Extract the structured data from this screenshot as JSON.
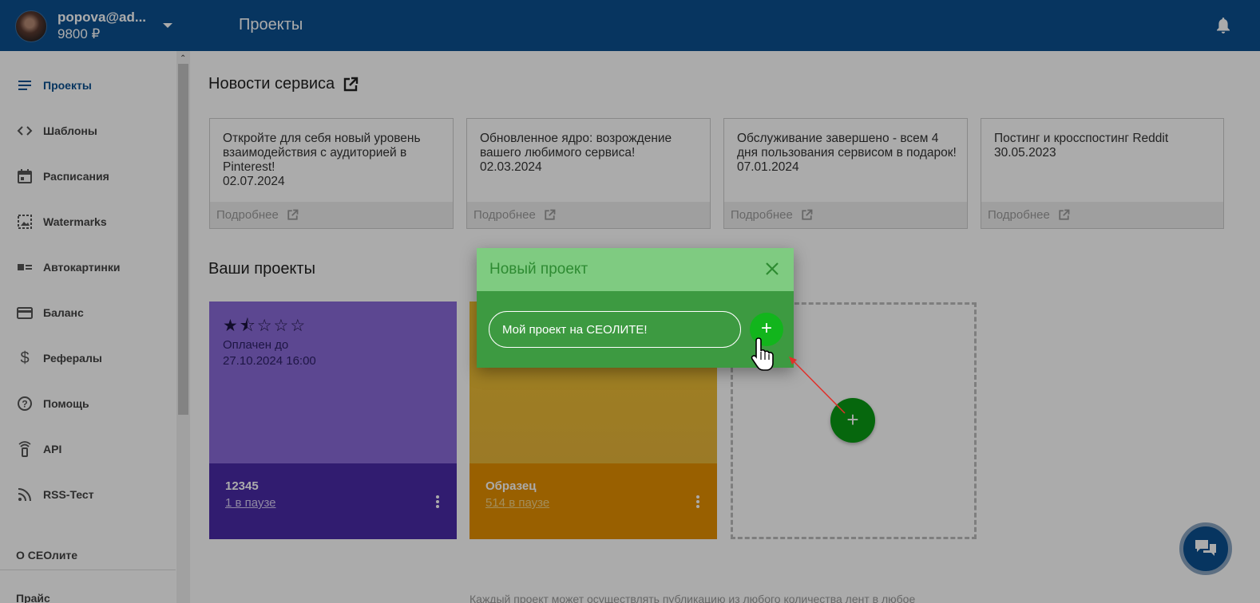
{
  "header": {
    "user_email": "popova@ad...",
    "user_balance": "9800 ₽",
    "page_title": "Проекты"
  },
  "sidebar": {
    "items": [
      {
        "label": "Проекты",
        "icon": "list-icon"
      },
      {
        "label": "Шаблоны",
        "icon": "code-icon"
      },
      {
        "label": "Расписания",
        "icon": "calendar-icon"
      },
      {
        "label": "Watermarks",
        "icon": "image-icon"
      },
      {
        "label": "Автокартинки",
        "icon": "picture-card-icon"
      },
      {
        "label": "Баланс",
        "icon": "credit-card-icon"
      },
      {
        "label": "Рефералы",
        "icon": "dollar-icon"
      },
      {
        "label": "Помощь",
        "icon": "help-icon"
      },
      {
        "label": "API",
        "icon": "api-icon"
      },
      {
        "label": "RSS-Тест",
        "icon": "rss-icon"
      }
    ],
    "about": "О СЕОлите",
    "price": "Прайс"
  },
  "news": {
    "title": "Новости сервиса",
    "more_label": "Подробнее",
    "cards": [
      {
        "text": "Откройте для себя новый уровень взаимодействия с аудиторией в Pinterest!",
        "date": "02.07.2024"
      },
      {
        "text": "Обновленное ядро: возрождение вашего любимого сервиса!",
        "date": "02.03.2024"
      },
      {
        "text": "Обслуживание завершено - всем 4 дня пользования сервисом в подарок!",
        "date": "07.01.2024"
      },
      {
        "text": "Постинг и кросспостинг Reddit",
        "date": "30.05.2023"
      }
    ]
  },
  "projects": {
    "title": "Ваши проекты",
    "cards": [
      {
        "name": "12345",
        "paused": "1 в паузе",
        "stars": "★⯪☆☆☆",
        "rating": 1.5,
        "paid_label": "Оплачен до",
        "paid_date": "27.10.2024 16:00",
        "top_color": "#5a3f9a",
        "bottom_color": "#2f1a70",
        "link_color": "#d7cdf3"
      },
      {
        "name": "Образец",
        "paused": "514 в паузе",
        "top_color": "#b08a20",
        "bottom_color": "#a25f00",
        "link_color": "#f3d48a"
      }
    ]
  },
  "footer_note": "Каждый проект может осуществлять публикацию из любого количества лент в любое",
  "modal": {
    "title": "Новый проект",
    "input_value": "Мой проект на СЕОЛИТЕ!",
    "create_symbol": "+"
  },
  "add_symbol": "+",
  "colors": {
    "header": "#0b4f8f",
    "modal_head": "#7fcb81",
    "modal_body": "#3d9a41",
    "accent_green": "#0a9a14"
  }
}
